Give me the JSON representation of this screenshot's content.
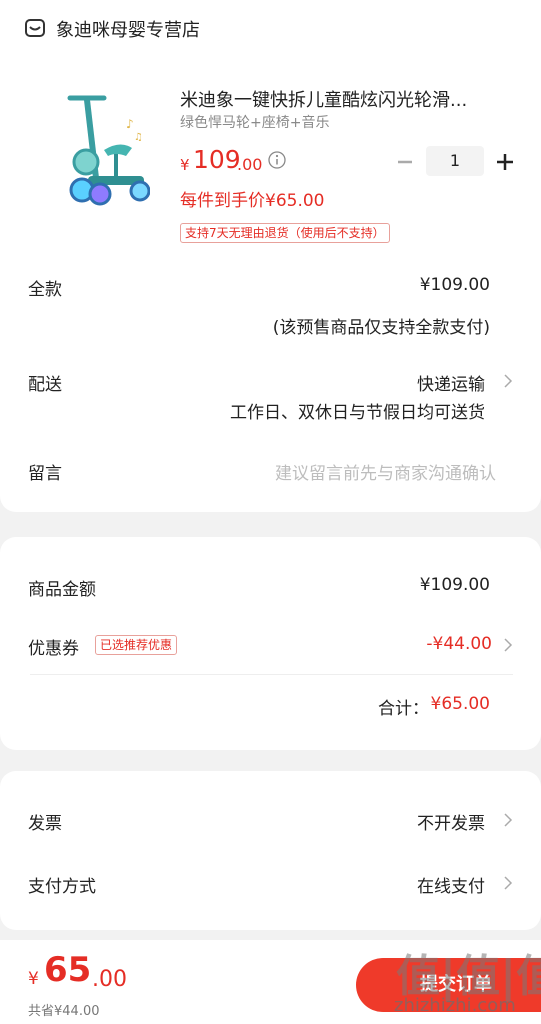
{
  "store": {
    "name": "象迪咪母婴专营店",
    "icon": "store-icon"
  },
  "product": {
    "title": "米迪象一键快拆儿童酷炫闪光轮滑...",
    "spec": "绿色悍马轮+座椅+音乐",
    "price_symbol": "¥",
    "price_int": "109",
    "price_dec": ".00",
    "quantity": "1",
    "per_item_price": "每件到手价¥65.00",
    "return_policy": "支持7天无理由退货（使用后不支持）",
    "image": "kids-scooter-image"
  },
  "payment_full": {
    "label": "全款",
    "value": "¥109.00",
    "note": "(该预售商品仅支持全款支付)"
  },
  "delivery": {
    "label": "配送",
    "value": "快递运输",
    "note": "工作日、双休日与节假日均可送货"
  },
  "message": {
    "label": "留言",
    "placeholder": "建议留言前先与商家沟通确认"
  },
  "summary": {
    "goods_label": "商品金额",
    "goods_value": "¥109.00",
    "coupon_label": "优惠券",
    "coupon_badge": "已选推荐优惠",
    "coupon_value": "-¥44.00",
    "subtotal_label": "合计：",
    "subtotal_value": "¥65.00"
  },
  "invoice": {
    "label": "发票",
    "value": "不开发票"
  },
  "pay_method": {
    "label": "支付方式",
    "value": "在线支付"
  },
  "footer": {
    "total_symbol": "¥",
    "total_int": "65",
    "total_dec": ".00",
    "saved": "共省¥44.00",
    "submit_label": "提交订单"
  },
  "watermark": {
    "main": "值|值|值",
    "sub": "zhizhizhi.com"
  },
  "colors": {
    "accent": "#e52d25",
    "button": "#ef3a2a"
  }
}
